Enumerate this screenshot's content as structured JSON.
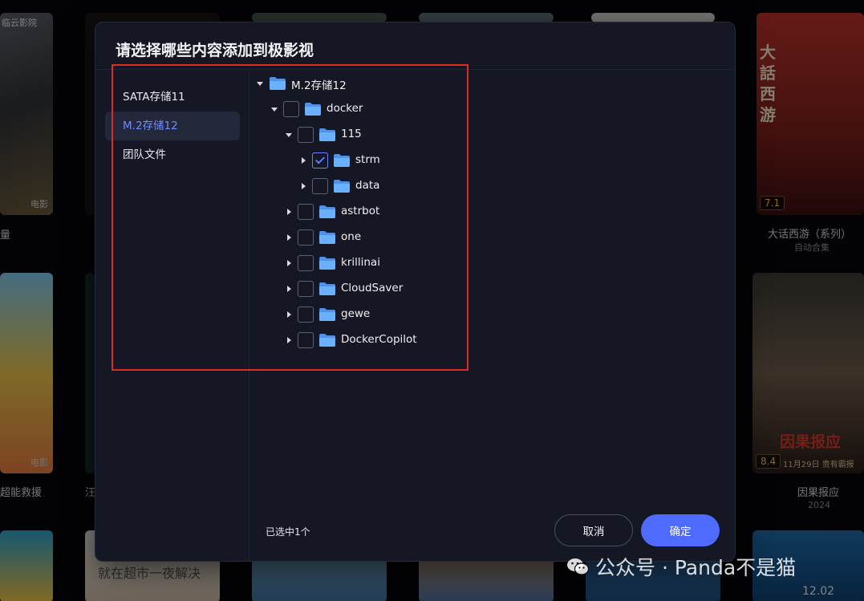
{
  "background": {
    "posters": [
      {
        "caption": "量",
        "tag": "电影",
        "poster_text": "临云影院"
      },
      {
        "caption": "大话西游（系列）",
        "subcaption": "自动合集",
        "rating": "7.1",
        "poster_text": "大話西游"
      },
      {
        "caption": "超能救援",
        "tag": "电影"
      },
      {
        "caption": "汪"
      },
      {
        "caption": "因果报应",
        "subcaption": "2024",
        "rating": "8.4",
        "poster_text": "因果报应",
        "date_text": "11月29日 贵有霸报"
      },
      {
        "caption": "就在超市一夜解决"
      },
      {
        "date_text": "12.02"
      }
    ]
  },
  "modal": {
    "title": "请选择哪些内容添加到极影视",
    "sidebar": {
      "items": [
        {
          "label": "SATA存储11",
          "active": false
        },
        {
          "label": "M.2存储12",
          "active": true
        },
        {
          "label": "团队文件",
          "active": false
        }
      ]
    },
    "tree": {
      "nodes": [
        {
          "label": "M.2存储12",
          "icon": "folder-icon",
          "expanded": true,
          "checkbox": false,
          "checked": false
        },
        {
          "label": "docker",
          "icon": "folder-icon",
          "expanded": true,
          "checkbox": true,
          "checked": false
        },
        {
          "label": "115",
          "icon": "folder-icon",
          "expanded": true,
          "checkbox": true,
          "checked": false
        },
        {
          "label": "strm",
          "icon": "folder-icon",
          "expanded": false,
          "checkbox": true,
          "checked": true
        },
        {
          "label": "data",
          "icon": "folder-icon",
          "expanded": false,
          "checkbox": true,
          "checked": false
        },
        {
          "label": "astrbot",
          "icon": "folder-icon",
          "expanded": false,
          "checkbox": true,
          "checked": false
        },
        {
          "label": "one",
          "icon": "folder-icon",
          "expanded": false,
          "checkbox": true,
          "checked": false
        },
        {
          "label": "krillinai",
          "icon": "folder-icon",
          "expanded": false,
          "checkbox": true,
          "checked": false
        },
        {
          "label": "CloudSaver",
          "icon": "folder-icon",
          "expanded": false,
          "checkbox": true,
          "checked": false
        },
        {
          "label": "gewe",
          "icon": "folder-icon",
          "expanded": false,
          "checkbox": true,
          "checked": false
        },
        {
          "label": "DockerCopilot",
          "icon": "folder-icon",
          "expanded": false,
          "checkbox": true,
          "checked": false
        }
      ]
    },
    "footer": {
      "selected_text": "已选中1个",
      "cancel_label": "取消",
      "confirm_label": "确定"
    },
    "colors": {
      "accent": "#4f6bff",
      "active_text": "#6f8dff",
      "folder": "#6ab0ff",
      "highlight": "#e02b22"
    }
  },
  "watermark": {
    "text": "公众号 · Panda不是猫",
    "icon": "wechat-icon"
  }
}
